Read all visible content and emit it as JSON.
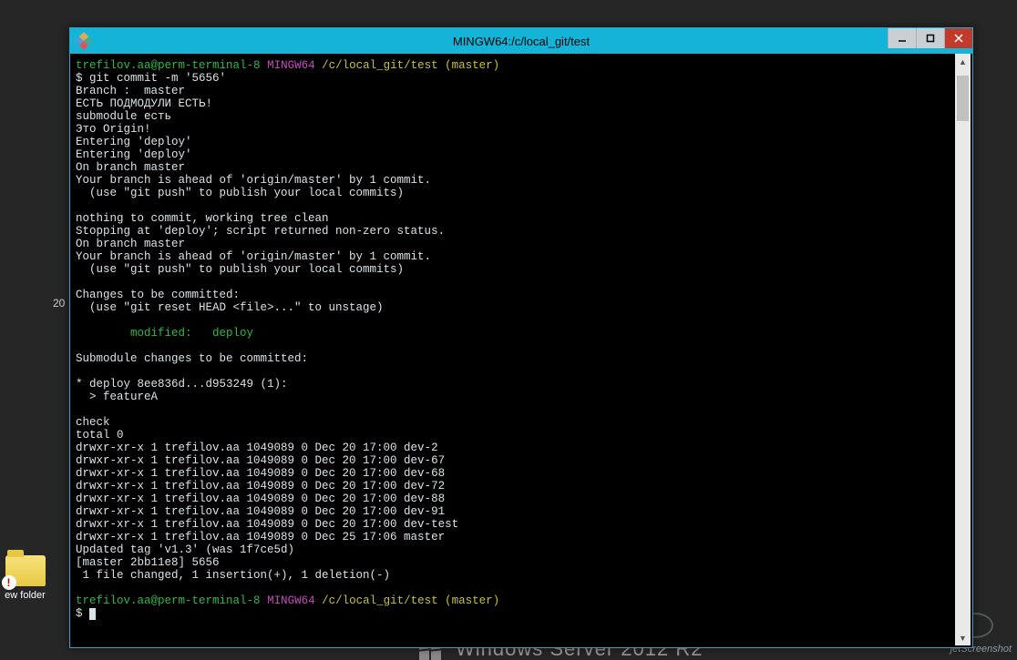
{
  "desktop": {
    "folder_label": "ew folder",
    "number_hint": "20",
    "os_text": "Windows Server 2012 R2",
    "watermark": "jetScreenshot"
  },
  "window": {
    "title": "MINGW64:/c/local_git/test"
  },
  "prompt": {
    "user": "trefilov.aa@perm-terminal-8",
    "env": "MINGW64",
    "path": "/c/local_git/test",
    "branch": "(master)"
  },
  "term": {
    "cmd1": "$ git commit -m '5656'",
    "l1": "Branch :  master",
    "l2": "ЕСТЬ ПОДМОДУЛИ ЕСТЬ!",
    "l3": "submodule есть",
    "l4": "Это Origin!",
    "l5": "Entering 'deploy'",
    "l6": "Entering 'deploy'",
    "l7": "On branch master",
    "l8": "Your branch is ahead of 'origin/master' by 1 commit.",
    "l9": "  (use \"git push\" to publish your local commits)",
    "l10": "",
    "l11": "nothing to commit, working tree clean",
    "l12": "Stopping at 'deploy'; script returned non-zero status.",
    "l13": "On branch master",
    "l14": "Your branch is ahead of 'origin/master' by 1 commit.",
    "l15": "  (use \"git push\" to publish your local commits)",
    "l16": "",
    "l17": "Changes to be committed:",
    "l18": "  (use \"git reset HEAD <file>...\" to unstage)",
    "l19": "",
    "l20": "        modified:   deploy",
    "l21": "",
    "l22": "Submodule changes to be committed:",
    "l23": "",
    "l24": "* deploy 8ee836d...d953249 (1):",
    "l25": "  > featureA",
    "l26": "",
    "l27": "check",
    "l28": "total 0",
    "ls": [
      "drwxr-xr-x 1 trefilov.aa 1049089 0 Dec 20 17:00 dev-2",
      "drwxr-xr-x 1 trefilov.aa 1049089 0 Dec 20 17:00 dev-67",
      "drwxr-xr-x 1 trefilov.aa 1049089 0 Dec 20 17:00 dev-68",
      "drwxr-xr-x 1 trefilov.aa 1049089 0 Dec 20 17:00 dev-72",
      "drwxr-xr-x 1 trefilov.aa 1049089 0 Dec 20 17:00 dev-88",
      "drwxr-xr-x 1 trefilov.aa 1049089 0 Dec 20 17:00 dev-91",
      "drwxr-xr-x 1 trefilov.aa 1049089 0 Dec 20 17:00 dev-test",
      "drwxr-xr-x 1 trefilov.aa 1049089 0 Dec 25 17:06 master"
    ],
    "l29": "Updated tag 'v1.3' (was 1f7ce5d)",
    "l30": "[master 2bb11e8] 5656",
    "l31": " 1 file changed, 1 insertion(+), 1 deletion(-)",
    "cmd2": "$ "
  }
}
